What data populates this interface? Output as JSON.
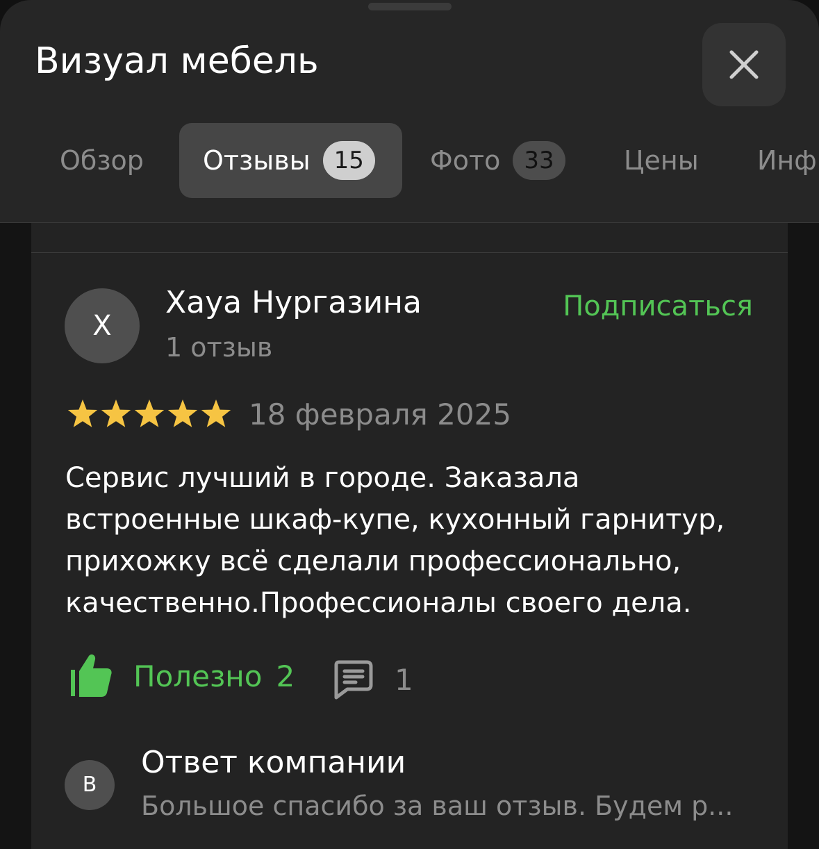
{
  "header": {
    "title": "Визуал мебель"
  },
  "tabs": [
    {
      "label": "Обзор",
      "active": false
    },
    {
      "label": "Отзывы",
      "badge": "15",
      "active": true
    },
    {
      "label": "Фото",
      "badge": "33",
      "active": false
    },
    {
      "label": "Цены",
      "active": false
    },
    {
      "label": "Инф",
      "active": false
    }
  ],
  "review": {
    "avatar_letter": "Х",
    "author": "Хауа Нургазина",
    "author_reviews": "1 отзыв",
    "subscribe_label": "Подписаться",
    "rating": 5,
    "date": "18 февраля 2025",
    "text_lines": [
      "Сервис лучший в городе. Заказала",
      "встроенные шкаф-купе, кухонный гарнитур,",
      "прихожку всё сделали профессионально,",
      "качественно.Профессионалы своего дела."
    ],
    "useful_label": "Полезно",
    "useful_count": "2",
    "comments_count": "1"
  },
  "company_reply": {
    "avatar_letter": "В",
    "title": "Ответ компании",
    "text": "Большое спасибо за ваш отзыв. Будем р..."
  },
  "colors": {
    "accent_green": "#53c555",
    "star_yellow": "#f6c443",
    "background": "#262626"
  },
  "icons": {
    "close": "close-icon",
    "star": "star-icon",
    "like": "thumbs-up-icon",
    "comment": "comment-icon"
  }
}
